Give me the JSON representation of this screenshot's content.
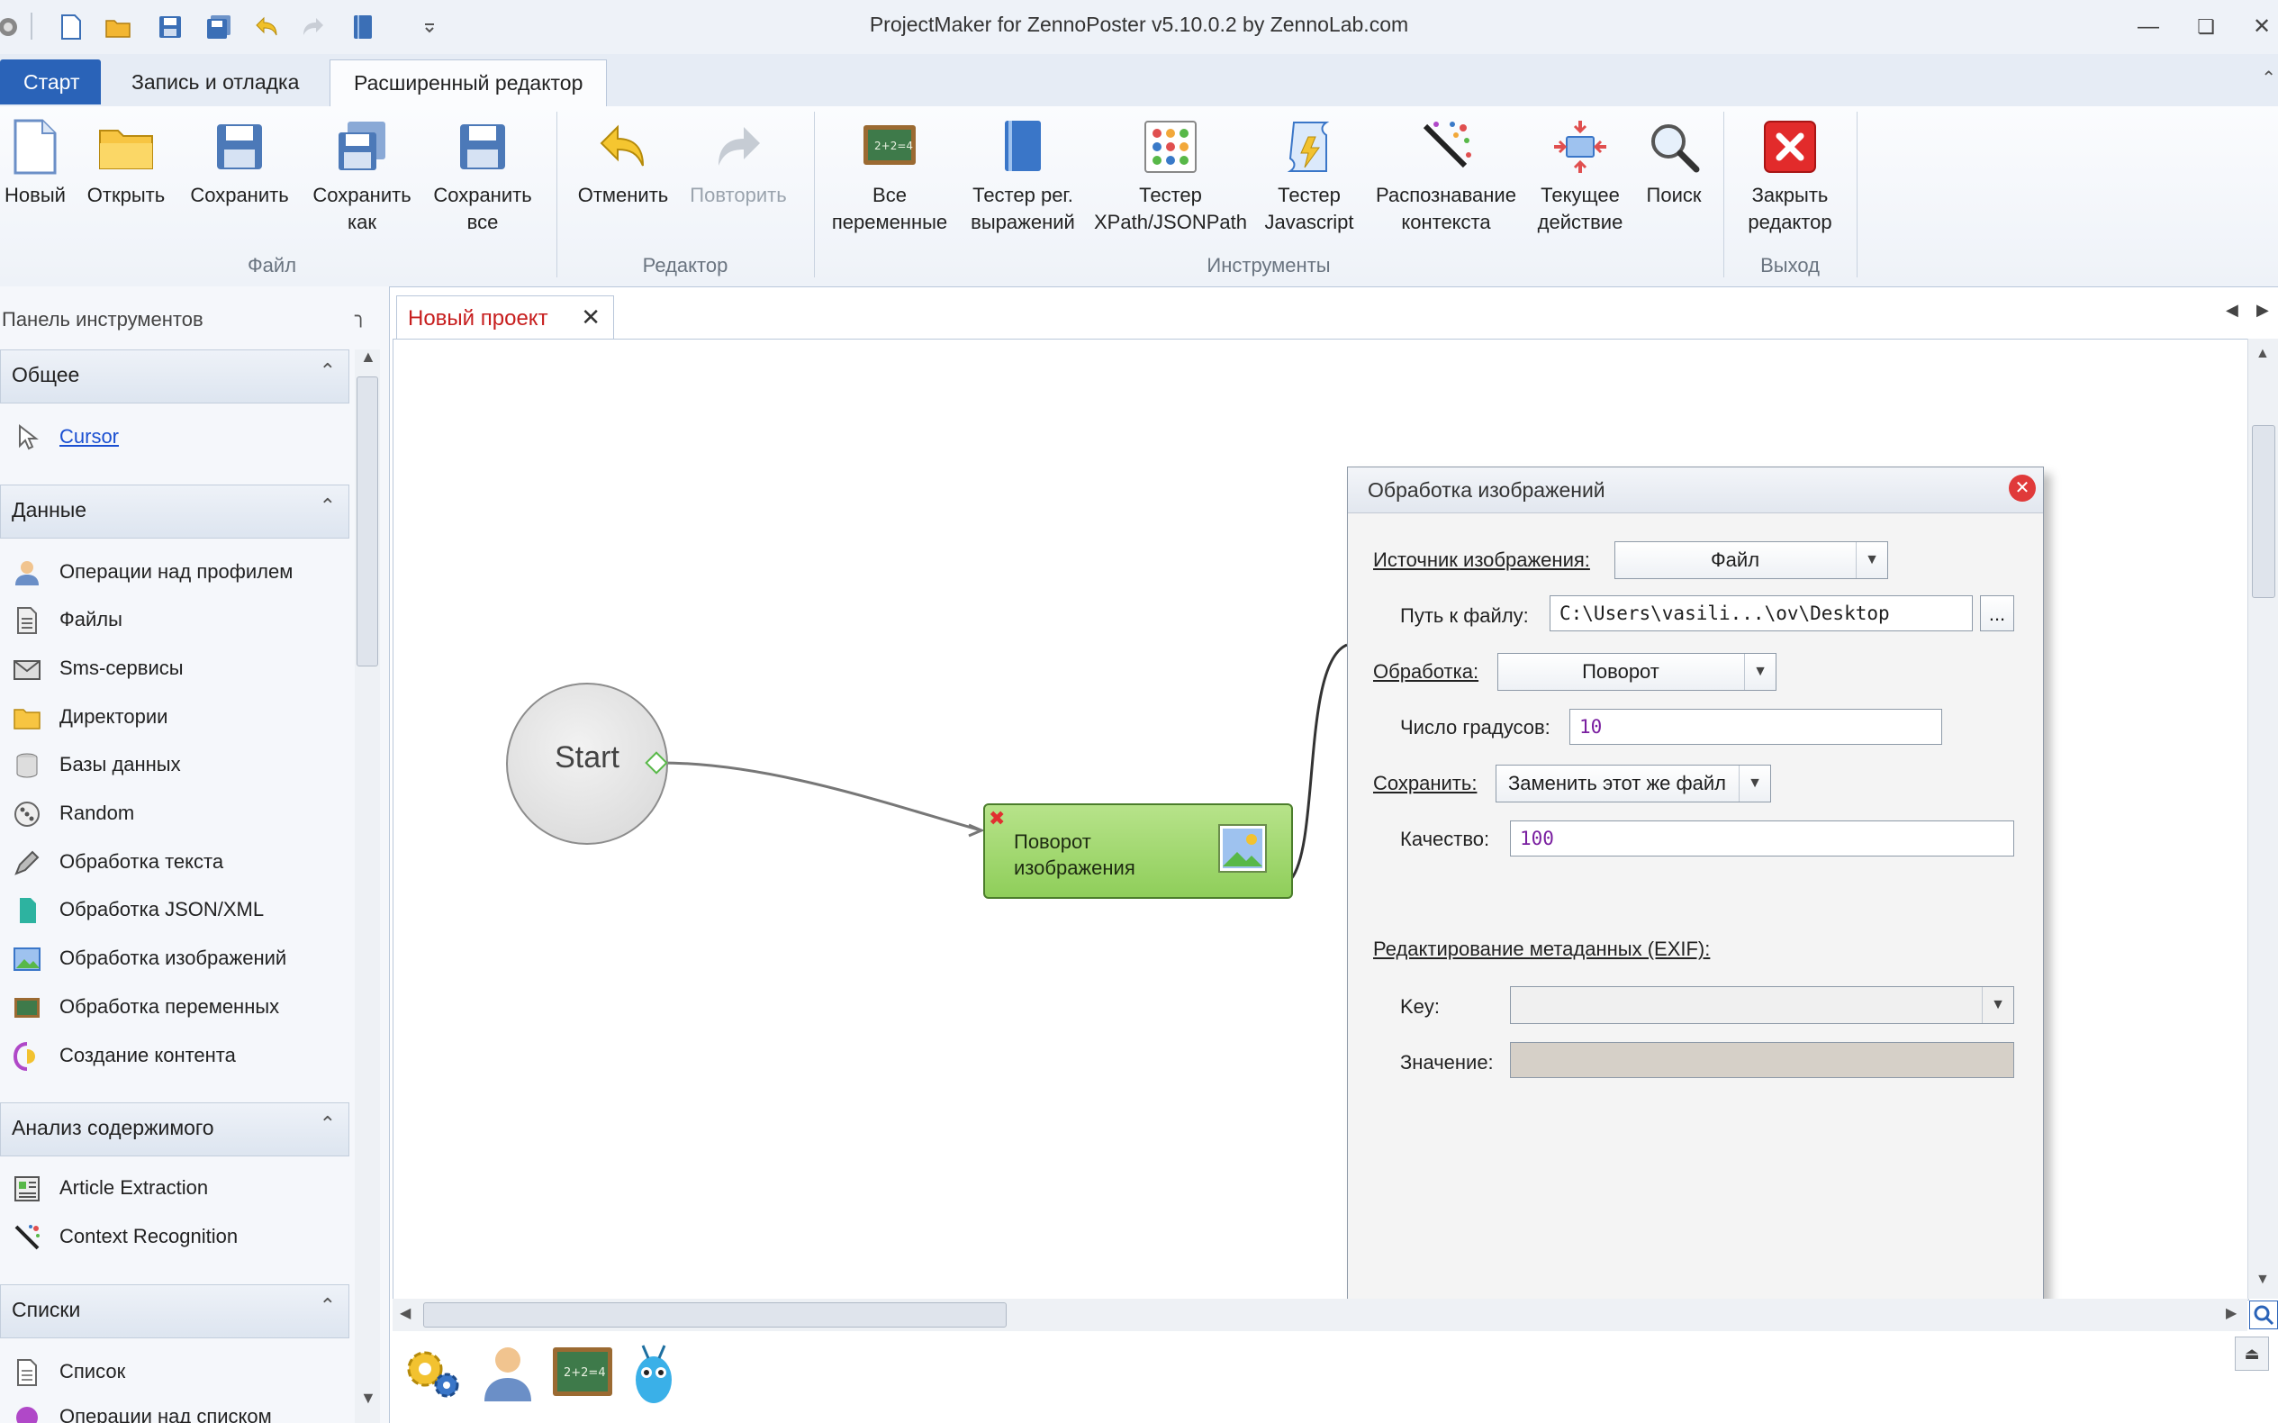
{
  "window": {
    "title": "ProjectMaker for ZennoPoster v5.10.0.2 by ZennoLab.com"
  },
  "quick_access": [
    "app-logo-icon",
    "new-file-icon",
    "open-folder-icon",
    "save-icon",
    "save-as-icon",
    "undo-icon",
    "redo-icon",
    "book-icon",
    "customize-icon"
  ],
  "tabs": [
    {
      "label": "Старт"
    },
    {
      "label": "Запись и отладка"
    },
    {
      "label": "Расширенный редактор"
    }
  ],
  "ribbon": {
    "groups": {
      "file": "Файл",
      "editor": "Редактор",
      "tools": "Инструменты",
      "exit": "Выход"
    },
    "new": "Новый",
    "open": "Открыть",
    "save": "Сохранить",
    "save_as_1": "Сохранить",
    "save_as_2": "как",
    "save_all_1": "Сохранить",
    "save_all_2": "все",
    "undo": "Отменить",
    "redo": "Повторить",
    "all_vars_1": "Все",
    "all_vars_2": "переменные",
    "regex_1": "Тестер рег.",
    "regex_2": "выражений",
    "xpath_1": "Тестер",
    "xpath_2": "XPath/JSONPath",
    "js_1": "Тестер",
    "js_2": "Javascript",
    "ctx_1": "Распознавание",
    "ctx_2": "контекста",
    "cur_1": "Текущее",
    "cur_2": "действие",
    "search": "Поиск",
    "close_1": "Закрыть",
    "close_2": "редактор"
  },
  "panel": {
    "title": "Панель инструментов",
    "sections": [
      {
        "name": "Общее"
      },
      {
        "name": "Данные"
      },
      {
        "name": "Анализ содержимого"
      },
      {
        "name": "Списки"
      }
    ],
    "general_items": [
      "Cursor"
    ],
    "data_items": [
      "Операции над профилем",
      "Файлы",
      "Sms-сервисы",
      "Директории",
      "Базы данных",
      "Random",
      "Обработка текста",
      "Обработка JSON/XML",
      "Обработка изображений",
      "Обработка переменных",
      "Создание контента"
    ],
    "analysis_items": [
      "Article Extraction",
      "Context Recognition"
    ],
    "list_items": [
      "Список",
      "Операции над списком"
    ]
  },
  "document": {
    "tab_title": "Новый проект"
  },
  "canvas": {
    "start_label": "Start",
    "action_line1": "Поворот",
    "action_line2": "изображения"
  },
  "dialog": {
    "title": "Обработка изображений",
    "source_label": "Источник изображения:",
    "source_value": "Файл",
    "path_label": "Путь к файлу:",
    "path_value": "C:\\Users\\vasili...\\ov\\Desktop",
    "browse_label": "...",
    "processing_label": "Обработка:",
    "processing_value": "Поворот",
    "degrees_label": "Число градусов:",
    "degrees_value": "10",
    "save_label": "Сохранить:",
    "save_value": "Заменить этот же файл",
    "quality_label": "Качество:",
    "quality_value": "100",
    "exif_label": "Редактирование метаданных (EXIF):",
    "key_label": "Key:",
    "key_value": "",
    "value_label": "Значение:",
    "value_value": ""
  },
  "bottom_tools": [
    "settings-gears-icon",
    "user-profile-icon",
    "chalkboard-icon",
    "bot-icon"
  ],
  "colors": {
    "accent": "#2a63b8",
    "node_green": "#8fce5a",
    "doc_tab_text": "#c71e1e"
  }
}
